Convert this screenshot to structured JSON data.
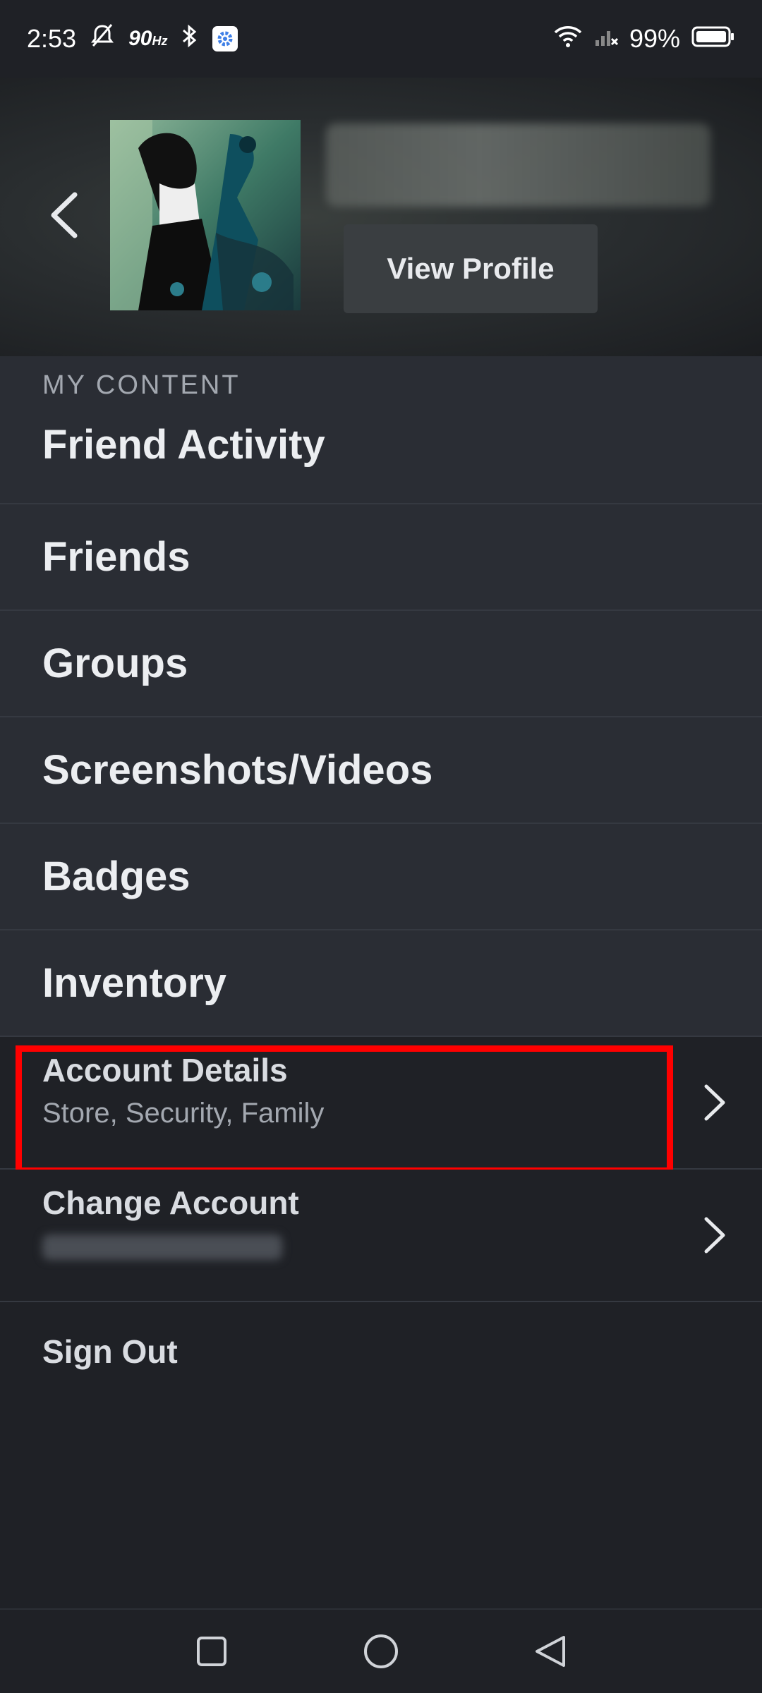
{
  "status_bar": {
    "time": "2:53",
    "refresh_rate": "90",
    "refresh_unit": "Hz",
    "battery": "99%",
    "icons": [
      "mute-icon",
      "bluetooth-icon",
      "settings-icon",
      "wifi-icon",
      "signal-icon",
      "battery-icon"
    ]
  },
  "profile": {
    "view_profile_label": "View Profile"
  },
  "menu": {
    "section_label": "MY CONTENT",
    "items": [
      {
        "label": "Friend Activity"
      },
      {
        "label": "Friends"
      },
      {
        "label": "Groups"
      },
      {
        "label": "Screenshots/Videos"
      },
      {
        "label": "Badges"
      },
      {
        "label": "Inventory"
      }
    ],
    "account_details": {
      "title": "Account Details",
      "subtitle": "Store, Security, Family"
    },
    "change_account": {
      "title": "Change Account"
    },
    "sign_out": "Sign Out"
  },
  "colors": {
    "accent_highlight": "#ff0000",
    "background": "#1f2126",
    "panel": "#2a2d34"
  }
}
